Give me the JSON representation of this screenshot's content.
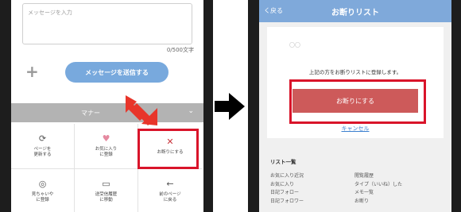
{
  "left_screen": {
    "message_placeholder": "メッセージを入力",
    "char_counter": "0/500文字",
    "plus_symbol": "+",
    "send_label": "メッセージを送信する",
    "manner_label": "マナー",
    "manner_chevron": "⌄",
    "actions": [
      {
        "icon": "refresh-icon",
        "glyph": "⟳",
        "label": "ページを\n更新する"
      },
      {
        "icon": "heart-icon",
        "glyph": "♥",
        "label": "お気に入り\nに登録"
      },
      {
        "icon": "close-icon",
        "glyph": "✕",
        "label": "お断りにする"
      },
      {
        "icon": "eye-slash-icon",
        "glyph": "◎",
        "label": "見ちゃいや\nに登録"
      },
      {
        "icon": "inbox-icon",
        "glyph": "▭",
        "label": "送受信履歴\nに移動"
      },
      {
        "icon": "arrow-left-icon",
        "glyph": "←",
        "label": "前のページ\nに戻る"
      }
    ],
    "pointer_arrow_color": "#e8352a",
    "highlight_color": "#d9142a"
  },
  "right_screen": {
    "back_label": "く戻る",
    "title": "お断りリスト",
    "user_name": "〇〇",
    "notice": "上記の方をお断りリストに登録します。",
    "refuse_button": "お断りにする",
    "cancel_link": "キャンセル",
    "list_title": "リスト一覧",
    "list_left": [
      "お気に入り近況",
      "お気に入り",
      "日記フォロー",
      "日記フォロワー"
    ],
    "list_right": [
      "閲覧履歴",
      "タイプ（いいね）した",
      "メモ一覧",
      "お断り"
    ],
    "header_color": "#7fa9da",
    "button_color": "#cd5a5a"
  }
}
